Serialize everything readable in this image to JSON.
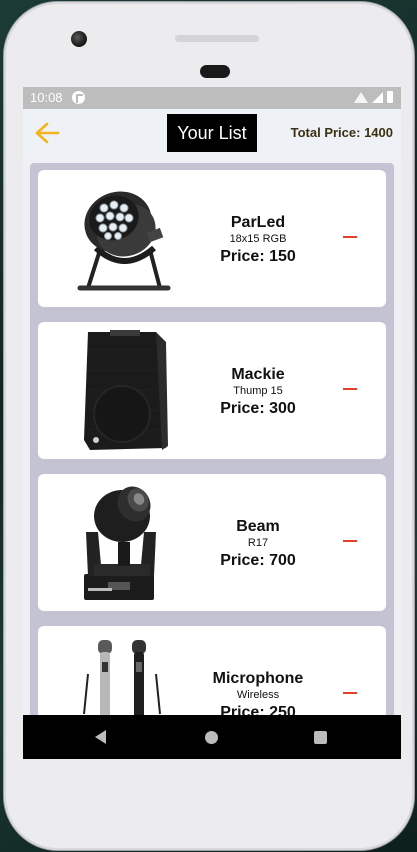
{
  "status": {
    "time": "10:08"
  },
  "header": {
    "title": "Your List",
    "total_label": "Total Price: 1400"
  },
  "items": [
    {
      "name": "ParLed",
      "sub": "18x15 RGB",
      "price": "Price: 150",
      "icon": "par-led-light-image"
    },
    {
      "name": "Mackie",
      "sub": "Thump 15",
      "price": "Price: 300",
      "icon": "speaker-image"
    },
    {
      "name": "Beam",
      "sub": "R17",
      "price": "Price: 700",
      "icon": "moving-head-beam-image"
    },
    {
      "name": "Microphone",
      "sub": "Wireless",
      "price": "Price: 250",
      "icon": "microphones-image"
    }
  ],
  "colors": {
    "accent": "#f2b31d",
    "remove": "#e0402c",
    "list_bg": "#c3c3d3"
  }
}
